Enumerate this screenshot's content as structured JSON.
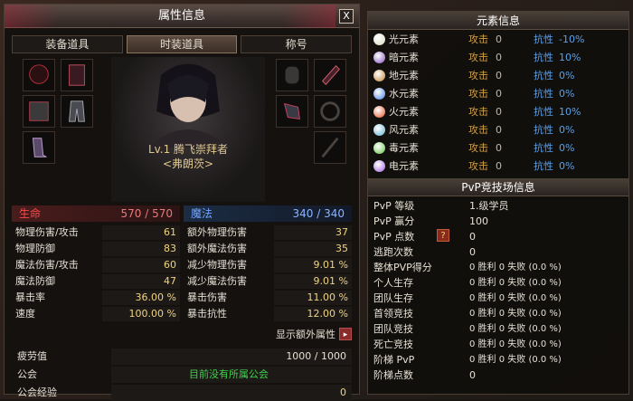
{
  "window": {
    "title": "属性信息",
    "close": "X"
  },
  "tabs": [
    "装备道具",
    "时装道具",
    "称号"
  ],
  "character": {
    "level_name": "Lv.1  腾飞崇拜者",
    "sub_name": "<弗朗茨>"
  },
  "hp": {
    "label": "生命",
    "value": "570 / 570"
  },
  "mp": {
    "label": "魔法",
    "value": "340 / 340"
  },
  "stats_left": [
    {
      "k": "物理伤害/攻击",
      "v": "61"
    },
    {
      "k": "物理防御",
      "v": "83"
    },
    {
      "k": "魔法伤害/攻击",
      "v": "60"
    },
    {
      "k": "魔法防御",
      "v": "47"
    },
    {
      "k": "暴击率",
      "v": "36.00 %"
    },
    {
      "k": "速度",
      "v": "100.00 %"
    }
  ],
  "stats_right": [
    {
      "k": "额外物理伤害",
      "v": "37"
    },
    {
      "k": "额外魔法伤害",
      "v": "35"
    },
    {
      "k": "减少物理伤害",
      "v": "9.01 %"
    },
    {
      "k": "减少魔法伤害",
      "v": "9.01 %"
    },
    {
      "k": "暴击伤害",
      "v": "11.00 %"
    },
    {
      "k": "暴击抗性",
      "v": "12.00 %"
    }
  ],
  "more": {
    "label": "显示额外属性",
    "arrow": "▸"
  },
  "bottom": {
    "fatigue": {
      "k": "疲劳值",
      "v": "1000 / 1000"
    },
    "guild": {
      "k": "公会",
      "v": "目前没有所属公会"
    },
    "guild_exp": {
      "k": "公会经验",
      "v": "0"
    }
  },
  "elements": {
    "title": "元素信息",
    "atk_label": "攻击",
    "res_label": "抗性",
    "rows": [
      {
        "name": "光元素",
        "atk": "0",
        "res": "-10%",
        "color": "#d8d8c0"
      },
      {
        "name": "暗元素",
        "atk": "0",
        "res": "10%",
        "color": "#8050c0"
      },
      {
        "name": "地元素",
        "atk": "0",
        "res": "0%",
        "color": "#c08030"
      },
      {
        "name": "水元素",
        "atk": "0",
        "res": "0%",
        "color": "#4080e0"
      },
      {
        "name": "火元素",
        "atk": "0",
        "res": "10%",
        "color": "#e05020"
      },
      {
        "name": "风元素",
        "atk": "0",
        "res": "0%",
        "color": "#60b0d0"
      },
      {
        "name": "毒元素",
        "atk": "0",
        "res": "0%",
        "color": "#60c040"
      },
      {
        "name": "电元素",
        "atk": "0",
        "res": "0%",
        "color": "#a060e0"
      }
    ]
  },
  "pvp": {
    "title": "PvP竞技场信息",
    "rows": [
      {
        "k": "PvP 等级",
        "v": "1.级学员"
      },
      {
        "k": "PvP 赢分",
        "v": "100"
      },
      {
        "k": "PvP 点数",
        "v": "0",
        "q": "?"
      },
      {
        "k": "逃跑次数",
        "v": "0"
      },
      {
        "k": "整体PVP得分",
        "v": "0 胜利 0 失败 (0.0 %)"
      },
      {
        "k": "个人生存",
        "v": "0 胜利 0 失败 (0.0 %)"
      },
      {
        "k": "团队生存",
        "v": "0 胜利 0 失败 (0.0 %)"
      },
      {
        "k": "首领竞技",
        "v": "0 胜利 0 失败 (0.0 %)"
      },
      {
        "k": "团队竞技",
        "v": "0 胜利 0 失败 (0.0 %)"
      },
      {
        "k": "死亡竞技",
        "v": "0 胜利 0 失败 (0.0 %)"
      },
      {
        "k": "阶梯 PvP",
        "v": "0 胜利 0 失败 (0.0 %)"
      },
      {
        "k": "阶梯点数",
        "v": "0"
      }
    ]
  }
}
